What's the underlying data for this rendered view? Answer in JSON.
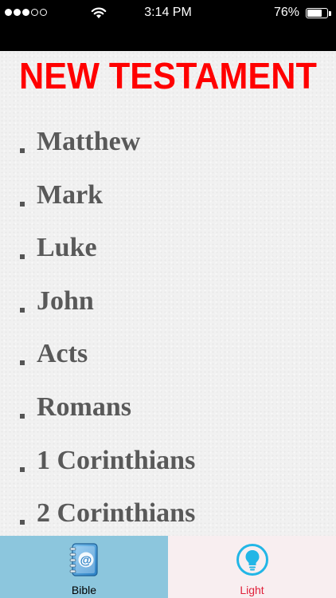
{
  "status_bar": {
    "time": "3:14 PM",
    "battery_percent": "76%",
    "battery_level": 0.76,
    "signal_bars_filled": 3,
    "signal_bars_total": 5
  },
  "section": {
    "heading": "NEW TESTAMENT",
    "heading_color": "#ff0000"
  },
  "books": [
    {
      "name": "Matthew"
    },
    {
      "name": "Mark"
    },
    {
      "name": "Luke"
    },
    {
      "name": "John"
    },
    {
      "name": "Acts"
    },
    {
      "name": "Romans"
    },
    {
      "name": "1 Corinthians"
    },
    {
      "name": "2 Corinthians"
    }
  ],
  "tab_bar": {
    "tabs": [
      {
        "label": "Bible",
        "icon": "address-book-icon",
        "selected": true,
        "color": "#8cc6dd"
      },
      {
        "label": "Light",
        "icon": "lightbulb-icon",
        "selected": false,
        "color": "#e0203a"
      }
    ]
  }
}
